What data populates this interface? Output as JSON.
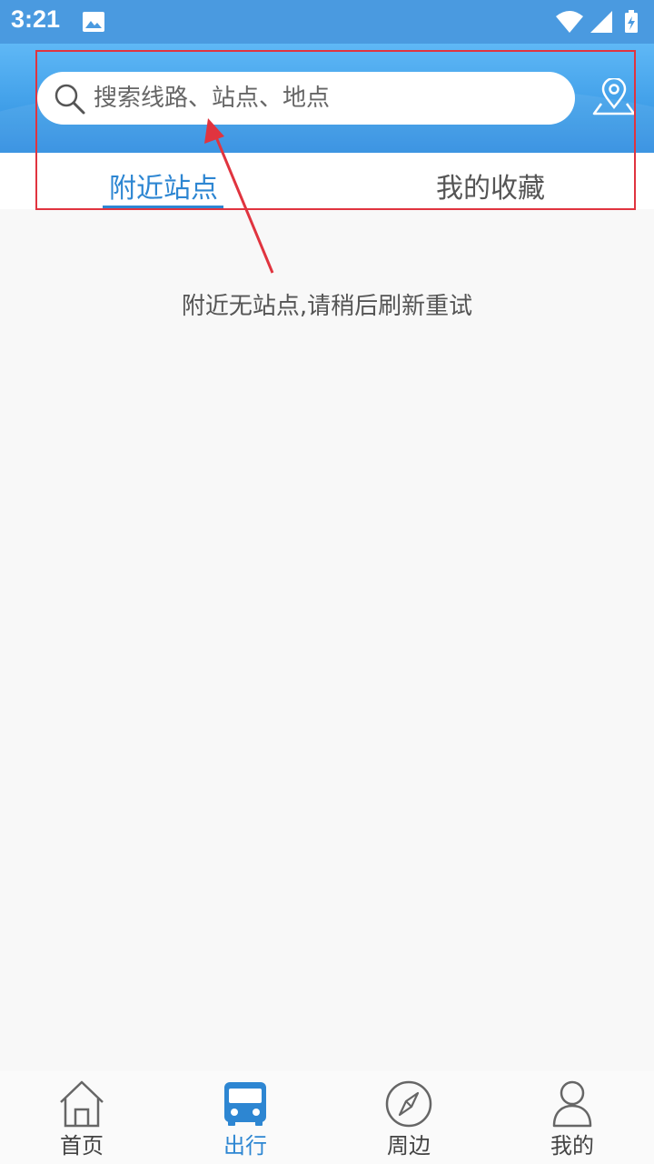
{
  "status_bar": {
    "time": "3:21"
  },
  "search": {
    "placeholder": "搜索线路、站点、地点"
  },
  "tabs": [
    {
      "label": "附近站点",
      "active": true
    },
    {
      "label": "我的收藏",
      "active": false
    }
  ],
  "empty_message": "附近无站点,请稍后刷新重试",
  "bottom_nav": [
    {
      "label": "首页",
      "icon": "home-icon",
      "active": false
    },
    {
      "label": "出行",
      "icon": "bus-icon",
      "active": true
    },
    {
      "label": "周边",
      "icon": "compass-icon",
      "active": false
    },
    {
      "label": "我的",
      "icon": "user-icon",
      "active": false
    }
  ],
  "colors": {
    "header_blue": "#3f9ee8",
    "accent": "#2d86d2",
    "annotation_red": "#e0343f"
  }
}
